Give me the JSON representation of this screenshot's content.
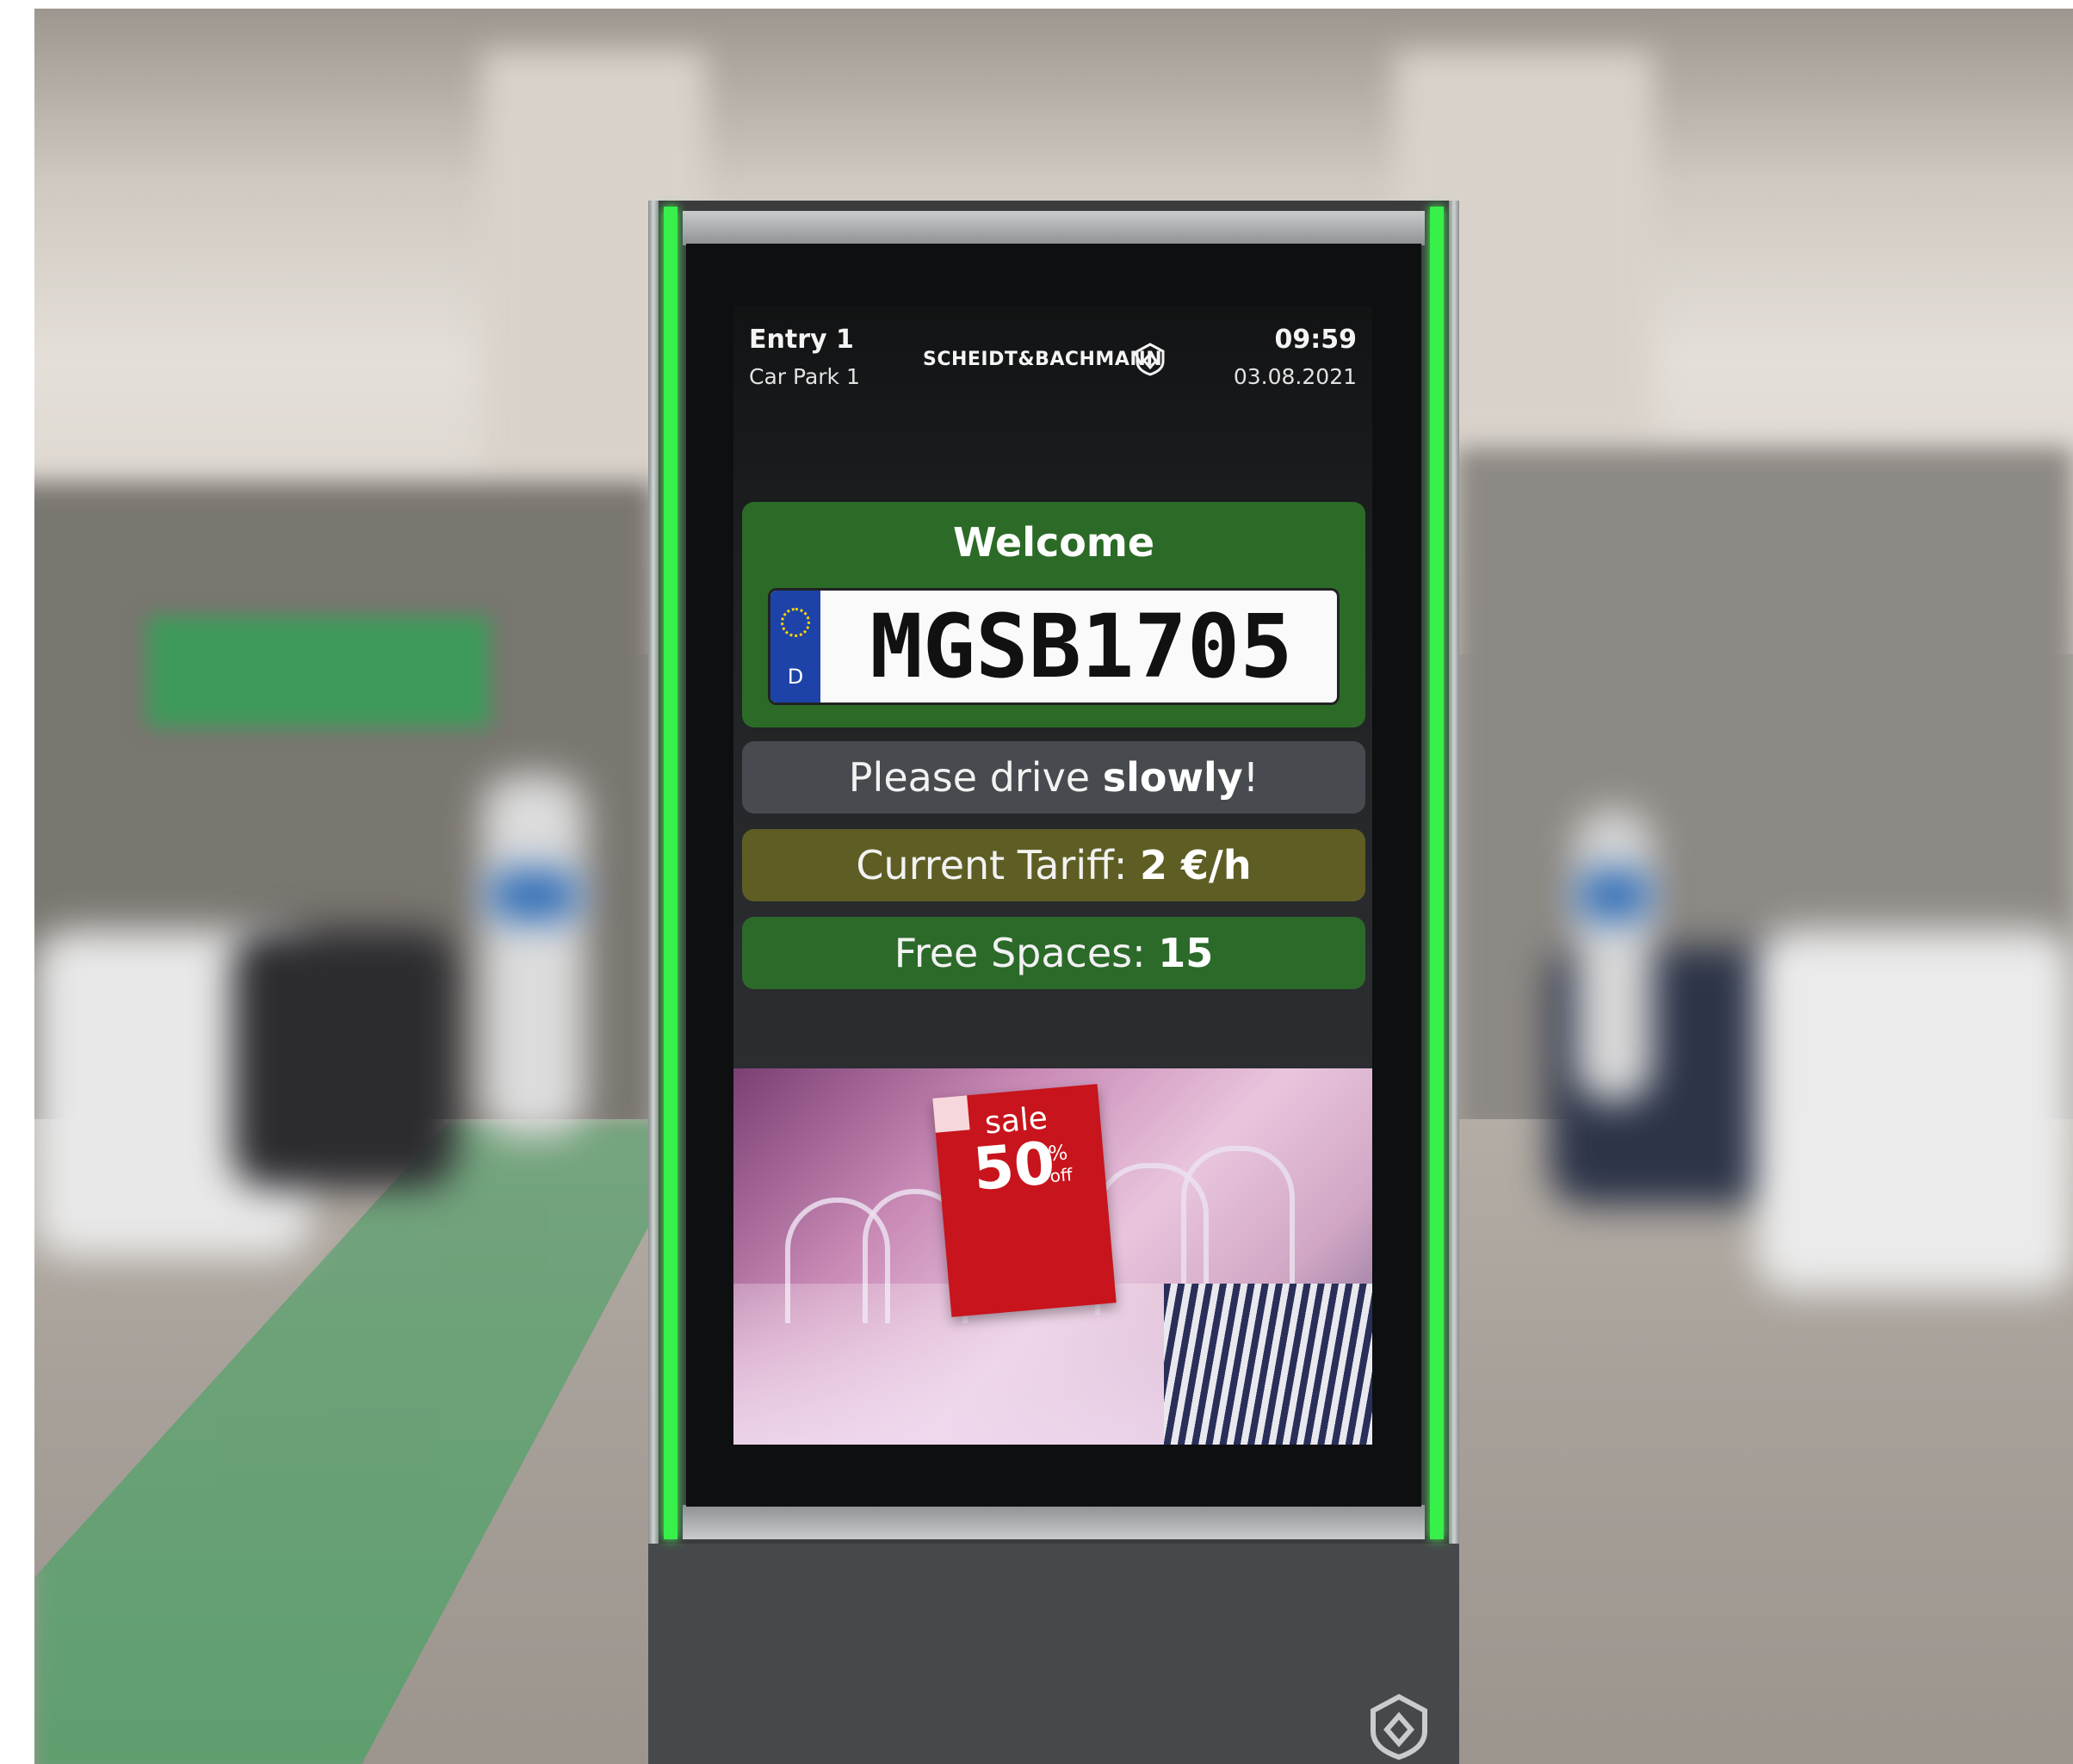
{
  "header": {
    "entry": "Entry 1",
    "car_park": "Car Park 1",
    "brand": "SCHEIDT&BACHMANN",
    "time": "09:59",
    "date": "03.08.2021"
  },
  "welcome": {
    "title": "Welcome",
    "plate": {
      "country": "D",
      "number": "MGSB1705"
    }
  },
  "messages": {
    "slow": {
      "prefix": "Please drive ",
      "emphasis": "slowly",
      "suffix": "!"
    },
    "tariff": {
      "prefix": "Current Tariff: ",
      "value": "2 €/h"
    },
    "spaces": {
      "prefix": "Free Spaces: ",
      "value": "15"
    }
  },
  "ad": {
    "sale": "sale",
    "percent_number": "50",
    "percent_sign": "%",
    "off": "off"
  },
  "colors": {
    "led": "#37f04a",
    "welcome_green": "#2b6b27",
    "slow_grey": "#474a4e",
    "tariff_olive": "#5e5e24",
    "spaces_green": "#2c6a2a",
    "plate_eu_blue": "#1d43a8",
    "sale_red": "#c8141c"
  },
  "icons": {
    "brand_logo": "sb-shield-icon",
    "base_logo": "sb-shield-icon"
  }
}
